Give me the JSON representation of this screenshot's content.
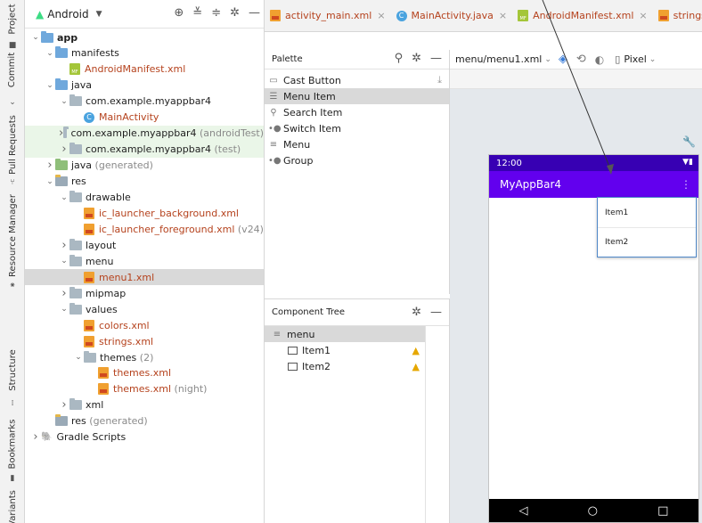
{
  "left_strip": {
    "tabs": [
      "Project",
      "Commit",
      "Pull Requests",
      "Resource Manager",
      "Structure",
      "Bookmarks",
      "Variants"
    ]
  },
  "project_panel": {
    "view_selector": "Android",
    "rows": [
      {
        "label": "app",
        "indent": 0,
        "arrow": "open",
        "icon": "folder-module",
        "bold": true
      },
      {
        "label": "manifests",
        "indent": 1,
        "arrow": "open",
        "icon": "folder-blue"
      },
      {
        "label": "AndroidManifest.xml",
        "indent": 2,
        "arrow": "",
        "icon": "manifest",
        "color": "red"
      },
      {
        "label": "java",
        "indent": 1,
        "arrow": "open",
        "icon": "folder-blue"
      },
      {
        "label": "com.example.myappbar4",
        "indent": 2,
        "arrow": "open",
        "icon": "folder"
      },
      {
        "label": "MainActivity",
        "indent": 3,
        "arrow": "",
        "icon": "class",
        "color": "red"
      },
      {
        "label": "com.example.myappbar4",
        "suffix": " (androidTest)",
        "indent": 2,
        "arrow": "closed",
        "icon": "folder",
        "hl": "green"
      },
      {
        "label": "com.example.myappbar4",
        "suffix": " (test)",
        "indent": 2,
        "arrow": "closed",
        "icon": "folder",
        "hl": "green"
      },
      {
        "label": "java",
        "suffix": " (generated)",
        "indent": 1,
        "arrow": "closed",
        "icon": "folder-gen"
      },
      {
        "label": "res",
        "indent": 1,
        "arrow": "open",
        "icon": "folder-res"
      },
      {
        "label": "drawable",
        "indent": 2,
        "arrow": "open",
        "icon": "folder"
      },
      {
        "label": "ic_launcher_background.xml",
        "indent": 3,
        "arrow": "",
        "icon": "xml",
        "color": "red"
      },
      {
        "label": "ic_launcher_foreground.xml",
        "suffix": " (v24)",
        "indent": 3,
        "arrow": "",
        "icon": "xml",
        "color": "red"
      },
      {
        "label": "layout",
        "indent": 2,
        "arrow": "closed",
        "icon": "folder"
      },
      {
        "label": "menu",
        "indent": 2,
        "arrow": "open",
        "icon": "folder"
      },
      {
        "label": "menu1.xml",
        "indent": 3,
        "arrow": "",
        "icon": "xml",
        "color": "red",
        "hl": "sel"
      },
      {
        "label": "mipmap",
        "indent": 2,
        "arrow": "closed",
        "icon": "folder"
      },
      {
        "label": "values",
        "indent": 2,
        "arrow": "open",
        "icon": "folder"
      },
      {
        "label": "colors.xml",
        "indent": 3,
        "arrow": "",
        "icon": "xml",
        "color": "red"
      },
      {
        "label": "strings.xml",
        "indent": 3,
        "arrow": "",
        "icon": "xml",
        "color": "red"
      },
      {
        "label": "themes",
        "suffix": " (2)",
        "indent": 3,
        "arrow": "open",
        "icon": "folder"
      },
      {
        "label": "themes.xml",
        "indent": 4,
        "arrow": "",
        "icon": "xml",
        "color": "red"
      },
      {
        "label": "themes.xml",
        "suffix": " (night)",
        "indent": 4,
        "arrow": "",
        "icon": "xml",
        "color": "red"
      },
      {
        "label": "xml",
        "indent": 2,
        "arrow": "closed",
        "icon": "folder"
      },
      {
        "label": "res",
        "suffix": " (generated)",
        "indent": 1,
        "arrow": "",
        "icon": "folder-res"
      },
      {
        "label": "Gradle Scripts",
        "indent": 0,
        "arrow": "closed",
        "icon": "gradle"
      }
    ]
  },
  "editor_tabs": [
    {
      "label": "activity_main.xml",
      "icon": "xml"
    },
    {
      "label": "MainActivity.java",
      "icon": "class"
    },
    {
      "label": "AndroidManifest.xml",
      "icon": "manifest"
    },
    {
      "label": "strings.xml",
      "icon": "xml"
    }
  ],
  "palette": {
    "title": "Palette",
    "items": [
      {
        "label": "Cast Button",
        "icon": "▭"
      },
      {
        "label": "Menu Item",
        "icon": "☰",
        "selected": true
      },
      {
        "label": "Search Item",
        "icon": "⚲"
      },
      {
        "label": "Switch Item",
        "icon": "•●"
      },
      {
        "label": "Menu",
        "icon": "≡"
      },
      {
        "label": "Group",
        "icon": "•●"
      }
    ]
  },
  "component_tree": {
    "title": "Component Tree",
    "root": "menu",
    "items": [
      "Item1",
      "Item2"
    ]
  },
  "design_toolbar": {
    "file_path": "menu/menu1.xml",
    "device": "Pixel"
  },
  "preview": {
    "time": "12:00",
    "app_title": "MyAppBar4",
    "menu_items": [
      "Item1",
      "Item2"
    ],
    "status_color": "#3700b3",
    "appbar_color": "#6200ee"
  }
}
